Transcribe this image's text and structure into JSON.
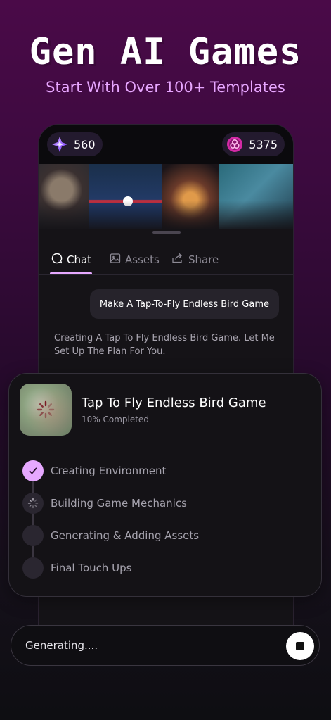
{
  "hero": {
    "title": "Gen AI Games",
    "subtitle": "Start With Over 100+ Templates"
  },
  "balances": {
    "gems": "560",
    "gems_icon": "purple-star-gem-icon",
    "coins": "5375",
    "coins_icon": "pink-token-icon"
  },
  "tabs": [
    {
      "label": "Chat",
      "icon": "chat-bubble-icon",
      "active": true
    },
    {
      "label": "Assets",
      "icon": "image-icon",
      "active": false
    },
    {
      "label": "Share",
      "icon": "share-icon",
      "active": false
    }
  ],
  "chat": {
    "user_message": "Make A Tap-To-Fly Endless Bird Game",
    "ai_message": "Creating A Tap To Fly Endless Bird Game. Let Me Set Up The Plan For You."
  },
  "progress": {
    "title": "Tap To Fly Endless Bird Game",
    "status": "10% Completed",
    "percent": 10,
    "steps": [
      {
        "label": "Creating Environment",
        "state": "done"
      },
      {
        "label": "Building Game Mechanics",
        "state": "in-progress"
      },
      {
        "label": "Generating & Adding Assets",
        "state": "pending"
      },
      {
        "label": "Final Touch Ups",
        "state": "pending"
      }
    ]
  },
  "input": {
    "status_text": "Generating...."
  },
  "colors": {
    "accent": "#e6a8ff",
    "subtitle": "#e7a6ff"
  }
}
